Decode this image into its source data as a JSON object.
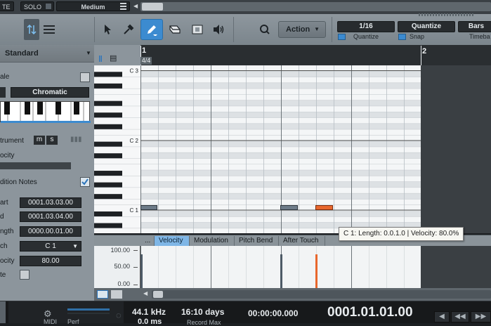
{
  "top_strip": {
    "fx_label": "TE",
    "solo_label": "SOLO",
    "preset": "Medium"
  },
  "toolbar": {
    "action_label": "Action",
    "quantize_value": "1/16",
    "quantize_label": "Quantize",
    "snap_value": "Quantize",
    "snap_label": "Snap",
    "timebase_value": "Bars",
    "timebase_label": "Timeba"
  },
  "inspector": {
    "layout_mode": "Standard",
    "scale_label": "ale",
    "scale_name": "Chromatic",
    "instrument_label": "trument",
    "m_button": "m",
    "s_button": "s",
    "velocity_label": "ocity",
    "audition_label": "dition Notes",
    "audition_checked": true,
    "fields": [
      {
        "label": "art",
        "value": "0001.03.03.00"
      },
      {
        "label": "d",
        "value": "0001.03.04.00"
      },
      {
        "label": "ngth",
        "value": "0000.00.01.00"
      },
      {
        "label": "ch",
        "value": "C 1"
      },
      {
        "label": "ocity",
        "value": "80.00"
      },
      {
        "label": "te",
        "value": ""
      }
    ]
  },
  "editor": {
    "ruler_marks": [
      "1",
      "2"
    ],
    "time_signature": "4/4",
    "octave_labels": [
      "C 3",
      "C 2",
      "C 1"
    ],
    "notes": [
      {
        "bar_pos": 1.0,
        "pitch": "C1",
        "selected": false
      },
      {
        "bar_pos": 2.0,
        "pitch": "C1",
        "selected": false
      },
      {
        "bar_pos": 2.5,
        "pitch": "C1",
        "selected": true
      }
    ]
  },
  "tooltip": {
    "text": "C 1:  Length: 0.0.1.0 | Velocity: 80.0%"
  },
  "lane": {
    "tabs": [
      "...",
      "Velocity",
      "Modulation",
      "Pitch Bend",
      "After Touch"
    ],
    "active_tab": "Velocity",
    "scale_labels": [
      "100.00",
      "50.00",
      "0.00"
    ],
    "velocities": [
      {
        "value": 80,
        "selected": false
      },
      {
        "value": 80,
        "selected": false
      },
      {
        "value": 80,
        "selected": true
      }
    ]
  },
  "transport": {
    "sample_rate": "44.1 kHz",
    "latency": "0.0 ms",
    "record_time": "16:10 days",
    "record_max": "Record Max",
    "timecode": "00:00:00.000",
    "position": "0001.01.01.00",
    "midi_label": "MIDI",
    "perf_label": "Perf"
  },
  "colors": {
    "accent": "#3c8bd0",
    "selected_note": "#e8672d",
    "note": "#6d7b88"
  }
}
